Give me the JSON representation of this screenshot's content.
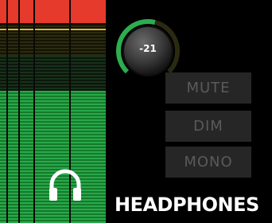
{
  "knob": {
    "value": "-21",
    "level": 0.55
  },
  "buttons": {
    "mute": "MUTE",
    "dim": "DIM",
    "mono": "MONO"
  },
  "section_label": "HEADPHONES",
  "icons": {
    "output": "headphones-icon"
  },
  "colors": {
    "meter_red": "#e53a2c",
    "meter_green": "#2aa84a",
    "knob_arc": "#2cae4f",
    "button_bg": "#262626",
    "button_text": "#5a5a5a"
  }
}
